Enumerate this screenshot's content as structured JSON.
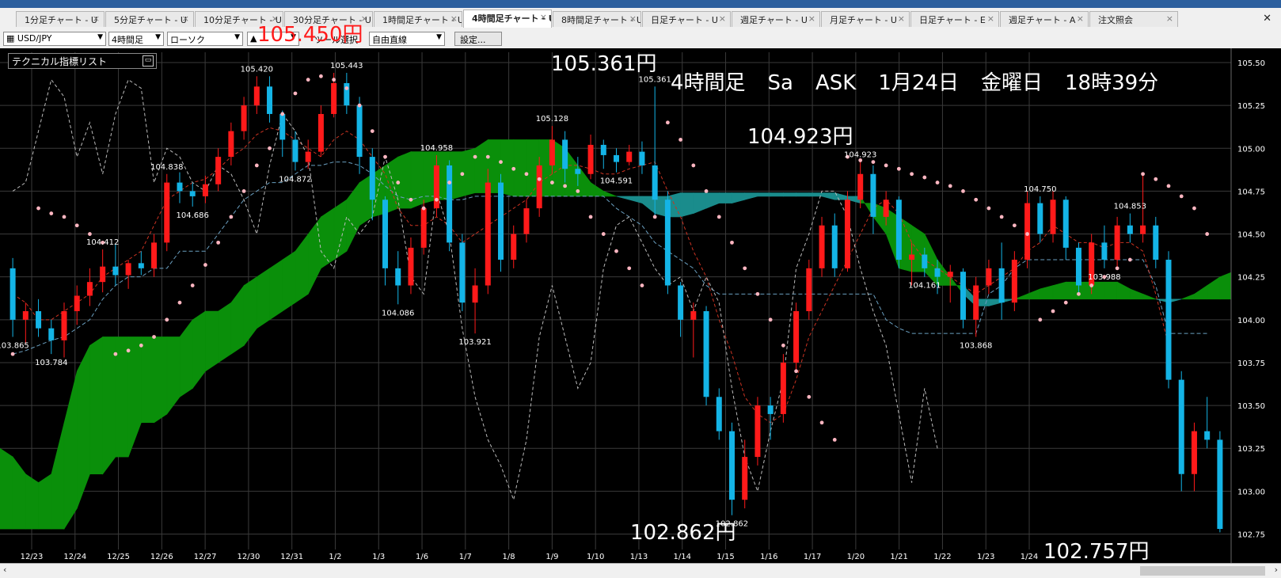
{
  "tabs": [
    {
      "label": "1分足チャート - U",
      "active": false
    },
    {
      "label": "5分足チャート - U",
      "active": false
    },
    {
      "label": "10分足チャート - U",
      "active": false
    },
    {
      "label": "30分足チャート - U",
      "active": false
    },
    {
      "label": "1時間足チャート - U",
      "active": false
    },
    {
      "label": "4時間足チャート - U",
      "active": true
    },
    {
      "label": "8時間足チャート - U",
      "active": false
    },
    {
      "label": "日足チャート - U",
      "active": false
    },
    {
      "label": "週足チャート - U",
      "active": false
    },
    {
      "label": "月足チャート - U",
      "active": false
    },
    {
      "label": "日足チャート - E",
      "active": false
    },
    {
      "label": "週足チャート - A",
      "active": false
    },
    {
      "label": "注文照会",
      "active": false
    }
  ],
  "toolbar": {
    "pair": "USD/JPY",
    "timeframe": "4時間足",
    "chart_type": "ローソク",
    "tool_label": "ツール選択",
    "tool_value": "自由直線",
    "settings_button": "設定..."
  },
  "panel": {
    "technical_list": "テクニカル指標リスト"
  },
  "annotations": {
    "red_price": "105.450円",
    "top_price": "105.361円",
    "mid_price": "104.923円",
    "low_price": "102.862円",
    "last_price": "102.757円",
    "header": [
      "4時間足",
      "Sa",
      "ASK",
      "1月24日",
      "金曜日",
      "18時39分"
    ]
  },
  "colors": {
    "background": "#000000",
    "up_candle": "#ff1a1a",
    "down_candle": "#14b4e6",
    "cloud_bull": "#0a8f0a",
    "cloud_bear": "#1a8c8c",
    "psar": "#ffb6c1",
    "grid": "#3a3a3a"
  },
  "chart_data": {
    "type": "candlestick",
    "pair": "USD/JPY",
    "timeframe": "4時間足",
    "ylim": [
      102.66,
      105.56
    ],
    "y_ticks": [
      105.5,
      105.25,
      105.0,
      104.75,
      104.5,
      104.25,
      104.0,
      103.75,
      103.5,
      103.25,
      103.0,
      102.75
    ],
    "x_ticks": [
      "12/23",
      "12/24",
      "12/25",
      "12/26",
      "12/27",
      "12/30",
      "12/31",
      "1/2",
      "1/3",
      "1/6",
      "1/7",
      "1/8",
      "1/9",
      "1/10",
      "1/13",
      "1/14",
      "1/15",
      "1/16",
      "1/17",
      "1/20",
      "1/21",
      "1/22",
      "1/23",
      "1/24"
    ],
    "candles": [
      [
        104.3,
        104.36,
        103.9,
        104.0
      ],
      [
        104.0,
        104.1,
        103.86,
        104.05
      ],
      [
        104.05,
        104.12,
        103.9,
        103.95
      ],
      [
        103.95,
        104.0,
        103.8,
        103.88
      ],
      [
        103.88,
        104.1,
        103.78,
        104.05
      ],
      [
        104.05,
        104.2,
        103.97,
        104.14
      ],
      [
        104.14,
        104.3,
        104.08,
        104.22
      ],
      [
        104.22,
        104.41,
        104.16,
        104.31
      ],
      [
        104.31,
        104.44,
        104.2,
        104.26
      ],
      [
        104.26,
        104.35,
        104.18,
        104.33
      ],
      [
        104.33,
        104.4,
        104.26,
        104.3
      ],
      [
        104.3,
        104.5,
        104.25,
        104.45
      ],
      [
        104.45,
        104.85,
        104.4,
        104.8
      ],
      [
        104.8,
        104.86,
        104.68,
        104.75
      ],
      [
        104.75,
        104.8,
        104.66,
        104.72
      ],
      [
        104.72,
        104.84,
        104.68,
        104.79
      ],
      [
        104.79,
        105.0,
        104.75,
        104.95
      ],
      [
        104.95,
        105.15,
        104.9,
        105.1
      ],
      [
        105.1,
        105.3,
        105.05,
        105.25
      ],
      [
        105.25,
        105.42,
        105.2,
        105.36
      ],
      [
        105.36,
        105.42,
        105.15,
        105.2
      ],
      [
        105.2,
        105.22,
        104.95,
        105.05
      ],
      [
        105.05,
        105.1,
        104.87,
        104.92
      ],
      [
        104.92,
        105.05,
        104.88,
        104.98
      ],
      [
        104.98,
        105.25,
        104.95,
        105.2
      ],
      [
        105.2,
        105.44,
        105.18,
        105.38
      ],
      [
        105.38,
        105.44,
        105.2,
        105.25
      ],
      [
        105.25,
        105.3,
        104.85,
        104.95
      ],
      [
        104.95,
        105.0,
        104.58,
        104.7
      ],
      [
        104.7,
        104.72,
        104.2,
        104.3
      ],
      [
        104.3,
        104.4,
        104.09,
        104.2
      ],
      [
        104.2,
        104.48,
        104.15,
        104.42
      ],
      [
        104.42,
        104.7,
        104.38,
        104.65
      ],
      [
        104.65,
        104.96,
        104.6,
        104.9
      ],
      [
        104.9,
        104.93,
        104.4,
        104.45
      ],
      [
        104.45,
        104.5,
        104.05,
        104.1
      ],
      [
        104.1,
        104.3,
        103.92,
        104.2
      ],
      [
        104.2,
        104.88,
        104.15,
        104.8
      ],
      [
        104.8,
        104.85,
        104.28,
        104.35
      ],
      [
        104.35,
        104.55,
        104.3,
        104.5
      ],
      [
        104.5,
        104.7,
        104.45,
        104.65
      ],
      [
        104.65,
        104.95,
        104.6,
        104.9
      ],
      [
        104.9,
        105.13,
        104.85,
        105.05
      ],
      [
        105.05,
        105.1,
        104.8,
        104.88
      ],
      [
        104.88,
        104.95,
        104.78,
        104.85
      ],
      [
        104.85,
        105.08,
        104.82,
        105.02
      ],
      [
        105.02,
        105.05,
        104.88,
        104.96
      ],
      [
        104.96,
        105.0,
        104.86,
        104.92
      ],
      [
        104.92,
        105.02,
        104.9,
        104.98
      ],
      [
        104.98,
        105.04,
        104.85,
        104.9
      ],
      [
        104.9,
        105.36,
        104.6,
        104.7
      ],
      [
        104.7,
        104.75,
        104.15,
        104.2
      ],
      [
        104.2,
        104.22,
        103.9,
        104.0
      ],
      [
        104.0,
        104.1,
        103.78,
        104.05
      ],
      [
        104.05,
        104.08,
        103.5,
        103.55
      ],
      [
        103.55,
        103.6,
        103.3,
        103.35
      ],
      [
        103.35,
        103.4,
        102.86,
        102.95
      ],
      [
        102.95,
        103.3,
        102.9,
        103.2
      ],
      [
        103.2,
        103.55,
        103.15,
        103.5
      ],
      [
        103.5,
        103.55,
        103.3,
        103.45
      ],
      [
        103.45,
        103.8,
        103.4,
        103.75
      ],
      [
        103.75,
        104.1,
        103.7,
        104.05
      ],
      [
        104.05,
        104.35,
        104.0,
        104.3
      ],
      [
        104.3,
        104.6,
        104.25,
        104.55
      ],
      [
        104.55,
        104.62,
        104.25,
        104.3
      ],
      [
        104.3,
        104.75,
        104.28,
        104.7
      ],
      [
        104.7,
        104.92,
        104.65,
        104.85
      ],
      [
        104.85,
        104.9,
        104.5,
        104.6
      ],
      [
        104.6,
        104.75,
        104.55,
        104.7
      ],
      [
        104.7,
        104.72,
        104.3,
        104.35
      ],
      [
        104.35,
        104.45,
        104.2,
        104.38
      ],
      [
        104.38,
        104.42,
        104.25,
        104.3
      ],
      [
        104.3,
        104.35,
        104.15,
        104.25
      ],
      [
        104.25,
        104.32,
        104.1,
        104.28
      ],
      [
        104.28,
        104.3,
        103.95,
        104.0
      ],
      [
        104.0,
        104.25,
        103.9,
        104.2
      ],
      [
        104.2,
        104.35,
        104.15,
        104.3
      ],
      [
        104.3,
        104.45,
        104.0,
        104.1
      ],
      [
        104.1,
        104.4,
        104.05,
        104.35
      ],
      [
        104.35,
        104.75,
        104.3,
        104.68
      ],
      [
        104.68,
        104.72,
        104.45,
        104.5
      ],
      [
        104.5,
        104.75,
        104.45,
        104.7
      ],
      [
        104.7,
        104.72,
        104.35,
        104.42
      ],
      [
        104.42,
        104.45,
        104.15,
        104.2
      ],
      [
        104.2,
        104.5,
        104.15,
        104.45
      ],
      [
        104.45,
        104.55,
        104.3,
        104.35
      ],
      [
        104.35,
        104.6,
        104.3,
        104.55
      ],
      [
        104.55,
        104.62,
        104.45,
        104.5
      ],
      [
        104.5,
        104.85,
        104.45,
        104.55
      ],
      [
        104.55,
        104.6,
        104.3,
        104.35
      ],
      [
        104.35,
        104.4,
        103.6,
        103.65
      ],
      [
        103.65,
        103.7,
        103.0,
        103.1
      ],
      [
        103.1,
        103.4,
        103.0,
        103.35
      ],
      [
        103.35,
        103.55,
        103.25,
        103.3
      ],
      [
        103.3,
        103.35,
        102.76,
        102.78
      ]
    ],
    "price_labels": [
      {
        "candle": 0,
        "value": "103.865",
        "pos": "below"
      },
      {
        "candle": 3,
        "value": "103.784",
        "pos": "below"
      },
      {
        "candle": 7,
        "value": "104.412",
        "pos": "above"
      },
      {
        "candle": 12,
        "value": "104.838",
        "pos": "above"
      },
      {
        "candle": 14,
        "value": "104.686",
        "pos": "below"
      },
      {
        "candle": 19,
        "value": "105.420",
        "pos": "above"
      },
      {
        "candle": 22,
        "value": "104.872",
        "pos": "below"
      },
      {
        "candle": 26,
        "value": "105.443",
        "pos": "above"
      },
      {
        "candle": 30,
        "value": "104.086",
        "pos": "below"
      },
      {
        "candle": 33,
        "value": "104.958",
        "pos": "above"
      },
      {
        "candle": 36,
        "value": "103.921",
        "pos": "below"
      },
      {
        "candle": 42,
        "value": "105.128",
        "pos": "above"
      },
      {
        "candle": 47,
        "value": "104.591",
        "pos": "below"
      },
      {
        "candle": 50,
        "value": "105.361",
        "pos": "above"
      },
      {
        "candle": 56,
        "value": "102.862",
        "pos": "below"
      },
      {
        "candle": 66,
        "value": "104.923",
        "pos": "above"
      },
      {
        "candle": 71,
        "value": "104.161",
        "pos": "below"
      },
      {
        "candle": 75,
        "value": "103.868",
        "pos": "below"
      },
      {
        "candle": 80,
        "value": "104.750",
        "pos": "above"
      },
      {
        "candle": 85,
        "value": "103.988",
        "pos": "below"
      },
      {
        "candle": 87,
        "value": "104.853",
        "pos": "above"
      }
    ],
    "cloud_a": [
      103.25,
      103.2,
      103.1,
      103.05,
      103.1,
      103.4,
      103.7,
      103.85,
      103.9,
      103.9,
      103.9,
      103.9,
      103.9,
      103.9,
      103.9,
      104.0,
      104.05,
      104.05,
      104.1,
      104.2,
      104.25,
      104.3,
      104.35,
      104.4,
      104.5,
      104.6,
      104.65,
      104.7,
      104.8,
      104.85,
      104.9,
      104.95,
      104.98,
      104.98,
      104.98,
      104.98,
      104.98,
      105.0,
      105.05,
      105.05,
      105.05,
      105.05,
      105.05,
      105.05,
      105.0,
      104.9,
      104.8,
      104.75,
      104.72,
      104.7,
      104.68,
      104.62,
      104.6,
      104.6,
      104.62,
      104.65,
      104.68,
      104.68,
      104.7,
      104.72,
      104.72,
      104.72,
      104.72,
      104.72,
      104.72,
      104.7,
      104.7,
      104.68,
      104.68,
      104.65,
      104.6,
      104.55,
      104.5,
      104.35,
      104.25,
      104.15,
      104.08,
      104.08,
      104.1,
      104.12,
      104.15,
      104.18,
      104.2,
      104.22,
      104.22,
      104.22,
      104.22,
      104.22,
      104.18,
      104.15,
      104.12,
      104.1,
      104.12,
      104.15,
      104.2,
      104.25,
      104.28,
      104.3,
      104.32,
      104.34,
      104.35,
      104.35,
      104.35,
      104.38,
      104.38,
      104.38,
      104.36,
      104.2,
      103.95,
      103.95,
      103.95,
      103.95
    ],
    "cloud_b": [
      102.78,
      102.78,
      102.78,
      102.78,
      102.78,
      102.78,
      102.9,
      103.1,
      103.1,
      103.2,
      103.2,
      103.4,
      103.4,
      103.45,
      103.55,
      103.6,
      103.7,
      103.75,
      103.8,
      103.85,
      103.95,
      104.0,
      104.05,
      104.1,
      104.15,
      104.3,
      104.35,
      104.4,
      104.55,
      104.6,
      104.62,
      104.65,
      104.65,
      104.68,
      104.7,
      104.7,
      104.72,
      104.74,
      104.74,
      104.74,
      104.72,
      104.72,
      104.72,
      104.72,
      104.72,
      104.72,
      104.72,
      104.72,
      104.72,
      104.72,
      104.72,
      104.72,
      104.72,
      104.74,
      104.74,
      104.74,
      104.74,
      104.74,
      104.74,
      104.74,
      104.74,
      104.74,
      104.74,
      104.74,
      104.74,
      104.74,
      104.72,
      104.72,
      104.6,
      104.5,
      104.3,
      104.28,
      104.28,
      104.2,
      104.2,
      104.2,
      104.12,
      104.12,
      104.12,
      104.12,
      104.12,
      104.12,
      104.12,
      104.12,
      104.12,
      104.12,
      104.12,
      104.12,
      104.12,
      104.12,
      104.12,
      104.12,
      104.12,
      104.12,
      104.12,
      104.12,
      104.12,
      104.12,
      104.12,
      104.12,
      104.12,
      104.12,
      104.12,
      104.12,
      104.12,
      104.12,
      104.12,
      104.12,
      103.9,
      103.9,
      103.9,
      103.9
    ],
    "psar": [
      103.8,
      null,
      104.65,
      104.62,
      104.6,
      104.55,
      104.5,
      104.45,
      103.8,
      103.82,
      103.85,
      103.9,
      104.0,
      104.1,
      104.2,
      104.32,
      104.45,
      104.6,
      104.75,
      104.9,
      105.0,
      105.2,
      105.32,
      105.4,
      105.42,
      105.4,
      105.35,
      105.25,
      105.1,
      104.95,
      104.8,
      104.7,
      104.65,
      104.7,
      104.8,
      104.85,
      104.95,
      104.95,
      104.92,
      104.88,
      104.85,
      104.82,
      104.8,
      104.78,
      104.75,
      104.6,
      104.5,
      104.4,
      104.3,
      104.2,
      104.6,
      105.15,
      105.05,
      104.9,
      104.75,
      104.6,
      104.45,
      104.3,
      104.15,
      104.0,
      103.85,
      103.7,
      103.55,
      103.4,
      103.3,
      104.95,
      104.93,
      104.92,
      104.9,
      104.88,
      104.85,
      104.83,
      104.8,
      104.78,
      104.75,
      104.7,
      104.65,
      104.6,
      104.55,
      104.5,
      104.0,
      104.05,
      104.1,
      104.15,
      104.2,
      104.25,
      104.3,
      104.35,
      104.85,
      104.82,
      104.78,
      104.72,
      104.65,
      104.5
    ],
    "kijun": [
      103.8,
      103.82,
      103.85,
      103.88,
      103.9,
      103.95,
      104.0,
      104.12,
      104.2,
      104.25,
      104.25,
      104.3,
      104.3,
      104.4,
      104.4,
      104.4,
      104.5,
      104.6,
      104.7,
      104.75,
      104.8,
      104.8,
      104.85,
      104.9,
      104.9,
      104.92,
      104.92,
      104.9,
      104.85,
      104.78,
      104.72,
      104.7,
      104.72,
      104.72,
      104.7,
      104.7,
      104.72,
      104.72,
      104.72,
      104.72,
      104.72,
      104.72,
      104.72,
      104.72,
      104.72,
      104.72,
      104.72,
      104.65,
      104.6,
      104.55,
      104.45,
      104.4,
      104.35,
      104.3,
      104.2,
      104.15,
      104.15,
      104.15,
      104.15,
      104.15,
      104.15,
      104.15,
      104.15,
      104.15,
      104.15,
      104.15,
      104.15,
      104.15,
      104.0,
      103.95,
      103.92,
      103.92,
      103.92,
      103.92,
      103.92,
      103.92,
      104.15,
      104.2,
      104.3,
      104.35,
      104.35,
      104.35,
      104.35,
      104.35,
      104.35,
      104.35,
      104.35,
      104.35,
      104.35,
      104.2,
      103.92,
      103.92,
      103.92,
      103.92
    ],
    "tenkan": [
      104.15,
      104.1,
      104.0,
      104.0,
      104.05,
      104.1,
      104.15,
      104.25,
      104.3,
      104.35,
      104.4,
      104.55,
      104.7,
      104.75,
      104.8,
      104.82,
      104.88,
      104.95,
      105.0,
      105.08,
      105.12,
      105.1,
      105.05,
      105.0,
      104.95,
      105.05,
      105.1,
      105.05,
      104.95,
      104.85,
      104.65,
      104.55,
      104.55,
      104.6,
      104.55,
      104.45,
      104.5,
      104.55,
      104.6,
      104.65,
      104.7,
      104.8,
      104.85,
      104.9,
      104.9,
      104.88,
      104.85,
      104.85,
      104.88,
      104.9,
      104.92,
      104.75,
      104.6,
      104.4,
      104.25,
      104.0,
      103.8,
      103.55,
      103.45,
      103.4,
      103.45,
      103.65,
      103.9,
      104.05,
      104.2,
      104.35,
      104.5,
      104.65,
      104.7,
      104.62,
      104.45,
      104.35,
      104.3,
      104.25,
      104.2,
      104.15,
      104.2,
      104.25,
      104.3,
      104.4,
      104.45,
      104.55,
      104.5,
      104.45,
      104.45,
      104.42,
      104.45,
      104.45,
      104.4,
      104.15,
      103.85
    ],
    "chikou": [
      104.75,
      104.8,
      105.1,
      105.4,
      105.3,
      104.95,
      105.15,
      104.85,
      105.2,
      105.4,
      105.35,
      104.8,
      105.0,
      104.95,
      104.8,
      104.75,
      104.9,
      104.85,
      104.7,
      104.5,
      104.9,
      105.2,
      105.1,
      104.95,
      104.4,
      104.3,
      104.6,
      104.5,
      104.6,
      104.95,
      104.7,
      104.25,
      104.15,
      104.75,
      104.5,
      103.95,
      103.55,
      103.3,
      103.15,
      102.95,
      103.3,
      103.9,
      104.2,
      103.9,
      103.6,
      103.75,
      104.3,
      104.55,
      104.6,
      104.45,
      104.3,
      104.2,
      104.25,
      104.05,
      104.25,
      104.1,
      103.6,
      103.2,
      103.0,
      103.35,
      103.65,
      104.3,
      104.5,
      104.75,
      104.75,
      104.6,
      104.3,
      104.05,
      103.85,
      103.45,
      103.05,
      103.6,
      103.25
    ]
  }
}
